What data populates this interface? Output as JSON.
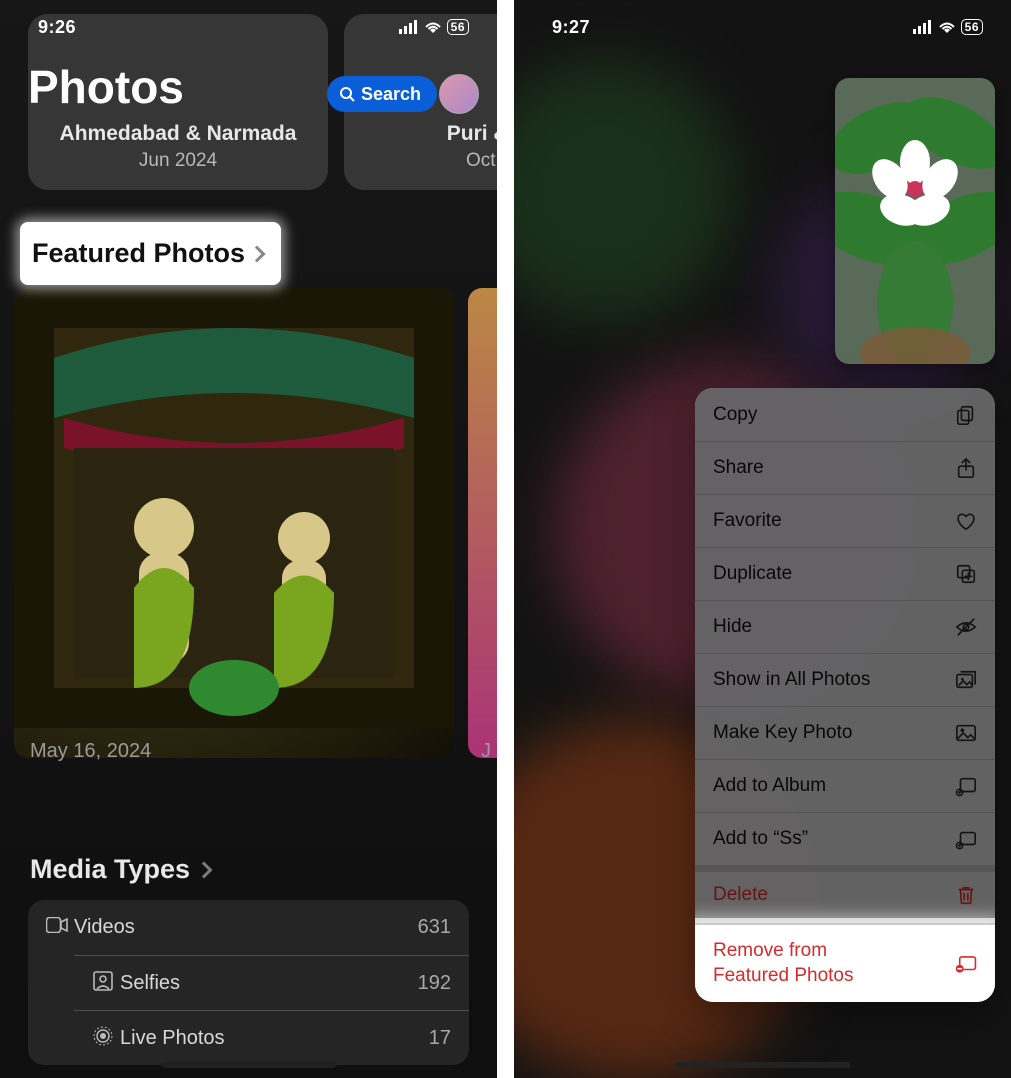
{
  "left": {
    "status": {
      "time": "9:26",
      "battery": "56"
    },
    "title": "Photos",
    "search_label": "Search",
    "trips": [
      {
        "title": "Ahmedabad & Narmada",
        "subtitle": "Jun 2024"
      },
      {
        "title": "Puri & Ka",
        "subtitle": "Oct 20"
      }
    ],
    "featured_heading": "Featured Photos",
    "featured_date": "May 16, 2024",
    "featured_date_next": "J",
    "media_heading": "Media Types",
    "media": [
      {
        "icon": "video-icon",
        "label": "Videos",
        "count": "631"
      },
      {
        "icon": "selfie-icon",
        "label": "Selfies",
        "count": "192"
      },
      {
        "icon": "live-icon",
        "label": "Live Photos",
        "count": "17"
      }
    ]
  },
  "right": {
    "status": {
      "time": "9:27",
      "battery": "56"
    },
    "menu": [
      {
        "label": "Copy",
        "icon": "copy-icon"
      },
      {
        "label": "Share",
        "icon": "share-icon"
      },
      {
        "label": "Favorite",
        "icon": "heart-icon"
      },
      {
        "label": "Duplicate",
        "icon": "duplicate-icon"
      },
      {
        "label": "Hide",
        "icon": "eye-slash-icon"
      },
      {
        "label": "Show in All Photos",
        "icon": "photos-icon"
      },
      {
        "label": "Make Key Photo",
        "icon": "photo-icon"
      },
      {
        "label": "Add to Album",
        "icon": "add-album-icon"
      },
      {
        "label": "Add to “Ss”",
        "icon": "add-album-icon"
      }
    ],
    "delete_label": "Delete",
    "remove_line1": "Remove from",
    "remove_line2": "Featured Photos"
  }
}
